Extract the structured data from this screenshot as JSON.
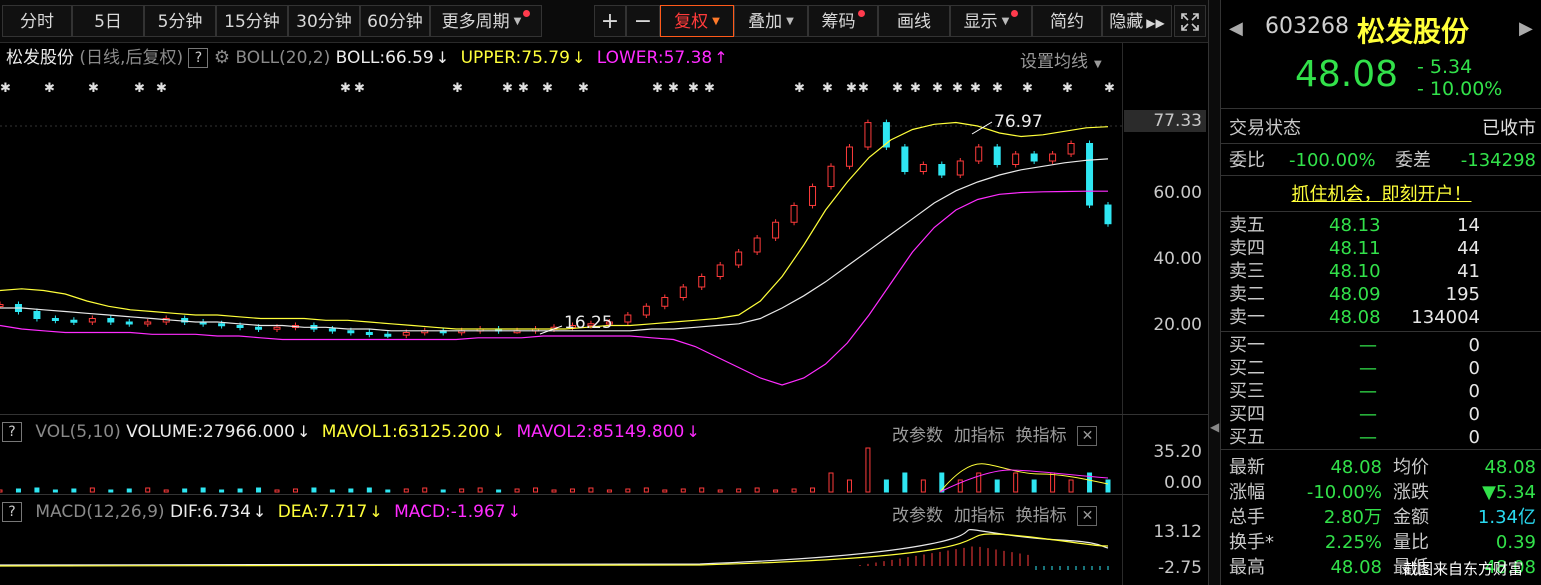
{
  "toolbar": {
    "buttons": [
      "分时",
      "5日",
      "5分钟",
      "15分钟",
      "30分钟",
      "60分钟",
      "更多周期",
      "+",
      "−",
      "复权",
      "叠加",
      "筹码",
      "画线",
      "显示",
      "简约",
      "隐藏"
    ]
  },
  "main_legend": {
    "stock": "松发股份",
    "mode": "(日线,后复权)",
    "help": "?",
    "indicator": "BOLL(20,2)",
    "boll": "BOLL:66.59",
    "upper": "UPPER:75.79",
    "lower": "LOWER:57.38",
    "settings": "设置均线"
  },
  "vol_legend": {
    "help": "?",
    "indicator": "VOL(5,10)",
    "volume": "VOLUME:27966.000",
    "mavol1": "MAVOL1:63125.200",
    "mavol2": "MAVOL2:85149.800"
  },
  "macd_legend": {
    "help": "?",
    "indicator": "MACD(12,26,9)",
    "dif": "DIF:6.734",
    "dea": "DEA:7.717",
    "macd": "MACD:-1.967"
  },
  "panel_links": {
    "params": "改参数",
    "add": "加指标",
    "switch": "换指标"
  },
  "axis": {
    "price_ticks": [
      "77.33",
      "60.00",
      "40.00",
      "20.00"
    ],
    "vol_ticks": [
      "35.20",
      "0.00"
    ],
    "macd_ticks": [
      "13.12",
      "-2.75"
    ],
    "annotation_high": "76.97",
    "annotation_low": "16.25"
  },
  "colors": {
    "up": "#ff3b3b",
    "down": "#2fe6f2",
    "boll_mid": "#e8e8e8",
    "boll_upper": "#ffff3a",
    "boll_lower": "#ff2cff",
    "price_green": "#32e14a"
  },
  "quote": {
    "code": "603268",
    "name": "松发股份",
    "price": "48.08",
    "change": "- 5.34",
    "change_pct": "- 10.00%",
    "trade_status_label": "交易状态",
    "trade_status": "已收市",
    "weibi_label": "委比",
    "weibi": "-100.00%",
    "weicha_label": "委差",
    "weicha": "-134298",
    "promo": "抓住机会，即刻开户！",
    "asks": [
      {
        "label": "卖五",
        "price": "48.13",
        "vol": "14"
      },
      {
        "label": "卖四",
        "price": "48.11",
        "vol": "44"
      },
      {
        "label": "卖三",
        "price": "48.10",
        "vol": "41"
      },
      {
        "label": "卖二",
        "price": "48.09",
        "vol": "195"
      },
      {
        "label": "卖一",
        "price": "48.08",
        "vol": "134004"
      }
    ],
    "bids": [
      {
        "label": "买一",
        "price": "—",
        "vol": "0"
      },
      {
        "label": "买二",
        "price": "—",
        "vol": "0"
      },
      {
        "label": "买三",
        "price": "—",
        "vol": "0"
      },
      {
        "label": "买四",
        "price": "—",
        "vol": "0"
      },
      {
        "label": "买五",
        "price": "—",
        "vol": "0"
      }
    ],
    "stats": [
      {
        "l1": "最新",
        "v1": "48.08",
        "l2": "均价",
        "v2": "48.08"
      },
      {
        "l1": "涨幅",
        "v1": "-10.00%",
        "l2": "涨跌",
        "v2": "▼5.34"
      },
      {
        "l1": "总手",
        "v1": "2.80万",
        "l2": "金额",
        "v2": "1.34亿"
      },
      {
        "l1": "换手*",
        "v1": "2.25%",
        "l2": "量比",
        "v2": "0.39"
      },
      {
        "l1": "最高",
        "v1": "48.08",
        "l2": "最低",
        "v2": "48.08"
      }
    ],
    "watermark": "截图来自东方财富"
  },
  "chart_data": {
    "type": "line",
    "title": "松发股份 日线 后复权",
    "ylim": [
      0,
      80
    ],
    "series": [
      {
        "name": "UPPER",
        "values": [
          29,
          29.5,
          29,
          28,
          26,
          24.5,
          23.5,
          23,
          22.5,
          22,
          22,
          21.5,
          21,
          21,
          21,
          20.5,
          20.5,
          20,
          19.5,
          19,
          18.5,
          18,
          18,
          18,
          18,
          18,
          18,
          18.5,
          19,
          19,
          19.5,
          20,
          20.5,
          21,
          22,
          26,
          33,
          42,
          52,
          60,
          67,
          72,
          75,
          76.5,
          77,
          76,
          74,
          73,
          73.5,
          74.5,
          75.5,
          75.8
        ]
      },
      {
        "name": "BOLL",
        "values": [
          24,
          24,
          23.5,
          23,
          22.5,
          22,
          21.5,
          21,
          20.5,
          20,
          20,
          19.5,
          19,
          19,
          18.5,
          18.5,
          18,
          18,
          17.5,
          17.5,
          17.5,
          17.5,
          17.5,
          17.5,
          17.5,
          17.5,
          17.5,
          17.5,
          17.5,
          17.5,
          18,
          18,
          18.5,
          19,
          19.5,
          21,
          24,
          27.5,
          31.5,
          36,
          40.5,
          45,
          49.5,
          54,
          57.5,
          60,
          62,
          63.5,
          64.5,
          65.5,
          66.2,
          66.59
        ]
      },
      {
        "name": "LOWER",
        "values": [
          19,
          18,
          17.5,
          17,
          17,
          17,
          17,
          16.5,
          16.5,
          16.5,
          16,
          16,
          15.5,
          15,
          15,
          15,
          15,
          15,
          15,
          15,
          15,
          15,
          15.5,
          15.5,
          15.5,
          16,
          16,
          16,
          16,
          16,
          15.5,
          15,
          13,
          10,
          7,
          4,
          2,
          4,
          8,
          14,
          22,
          31,
          40,
          47,
          52,
          55,
          56.5,
          57,
          57.2,
          57.3,
          57.38,
          57.38
        ]
      },
      {
        "name": "CLOSE",
        "values": [
          25,
          23,
          21,
          20.5,
          20,
          21,
          20,
          19.5,
          20,
          21,
          20,
          19.5,
          19,
          18.5,
          18,
          18.5,
          19,
          18,
          17.5,
          17,
          16.5,
          16.25,
          17,
          17.5,
          17,
          17.5,
          18,
          17.5,
          17.5,
          18,
          18.5,
          19,
          19.5,
          20,
          22,
          24.5,
          27,
          30,
          33,
          36.3,
          40,
          44,
          48.5,
          53.3,
          58.7,
          64.5,
          70,
          76.97,
          70,
          63,
          65,
          62,
          66,
          70,
          65,
          68,
          66,
          68,
          71,
          53.42,
          48.08
        ]
      }
    ]
  }
}
